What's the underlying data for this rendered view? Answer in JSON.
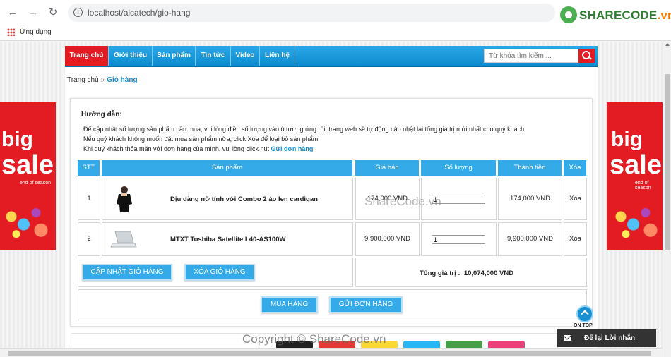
{
  "browser": {
    "url": "localhost/alcatech/gio-hang",
    "bookmarks_label": "Ứng dụng",
    "logo_text_main": "SHARECODE",
    "logo_text_suffix": ".vn"
  },
  "banner": {
    "big": "big",
    "sale": "sale",
    "subtitle": "end of season"
  },
  "nav": {
    "items": [
      "Trang chủ",
      "Giới thiệu",
      "Sản phẩm",
      "Tin tức",
      "Video",
      "Liên hệ"
    ],
    "search_placeholder": "Từ khóa tìm kiếm ..."
  },
  "breadcrumb": {
    "home": "Trang chủ",
    "separator": "»",
    "current": "Giỏ hàng"
  },
  "guide": {
    "title": "Hướng dẫn:",
    "line1": "Để cập nhật số lượng sản phẩm cần mua, vui lòng điền số lượng vào ô tương ứng rồi, trang web sẽ tự động cập nhật lại tổng giá trị mới nhất cho quý khách.",
    "line2": "Nếu quý khách không muốn đặt mua sản phẩm nữa, click Xóa để loại bỏ sản phẩm",
    "line3_prefix": "Khi quý khách thỏa mãn với đơn hàng của mình, vui lòng click nút ",
    "line3_link": "Gửi đơn hàng",
    "line3_suffix": "."
  },
  "table": {
    "headers": [
      "STT",
      "Sản phẩm",
      "Giá bán",
      "Số lượng",
      "Thành tiền",
      "Xóa"
    ],
    "rows": [
      {
        "stt": "1",
        "name": "Dịu dàng nữ tính với Combo 2 áo len cardigan",
        "price": "174,000 VND",
        "qty": "1",
        "subtotal": "174,000 VND",
        "delete": "Xóa"
      },
      {
        "stt": "2",
        "name": "MTXT Toshiba Satellite L40-AS100W",
        "price": "9,900,000 VND",
        "qty": "1",
        "subtotal": "9,900,000 VND",
        "delete": "Xóa"
      }
    ]
  },
  "actions": {
    "update": "CẬP NHẬT GIỎ HÀNG",
    "clear": "XÓA GIỎ HÀNG",
    "total_label": "Tổng giá trị :",
    "total_value": "10,074,000 VND",
    "buy": "MUA HÀNG",
    "send": "GỬI ĐƠN HÀNG"
  },
  "widgets": {
    "ontop": "ON TOP",
    "message": "Để lại Lời nhắn"
  },
  "watermarks": {
    "center": "ShareCode.vn",
    "bottom": "Copyright © ShareCode.vn"
  }
}
